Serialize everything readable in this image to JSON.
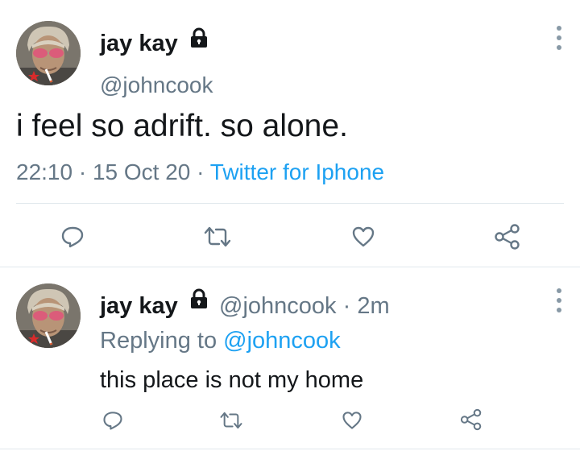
{
  "main_tweet": {
    "display_name": "jay kay",
    "handle": "@johncook",
    "text": "i feel so adrift. so alone.",
    "time": "22:10",
    "separator": " · ",
    "date": "15 Oct 20",
    "source": "Twitter for Iphone",
    "protected": true
  },
  "reply_tweet": {
    "display_name": "jay kay",
    "handle": "@johncook",
    "separator": " · ",
    "age": "2m",
    "replying_prefix": "Replying to ",
    "replying_to": "@johncook",
    "text": "this place is not my home",
    "protected": true
  },
  "actions": [
    "reply-icon",
    "retweet-icon",
    "like-icon",
    "share-icon"
  ],
  "colors": {
    "text": "#14171a",
    "secondary": "#657786",
    "link": "#1da1f2",
    "icon": "#657786",
    "divider": "#e1e8ed"
  }
}
